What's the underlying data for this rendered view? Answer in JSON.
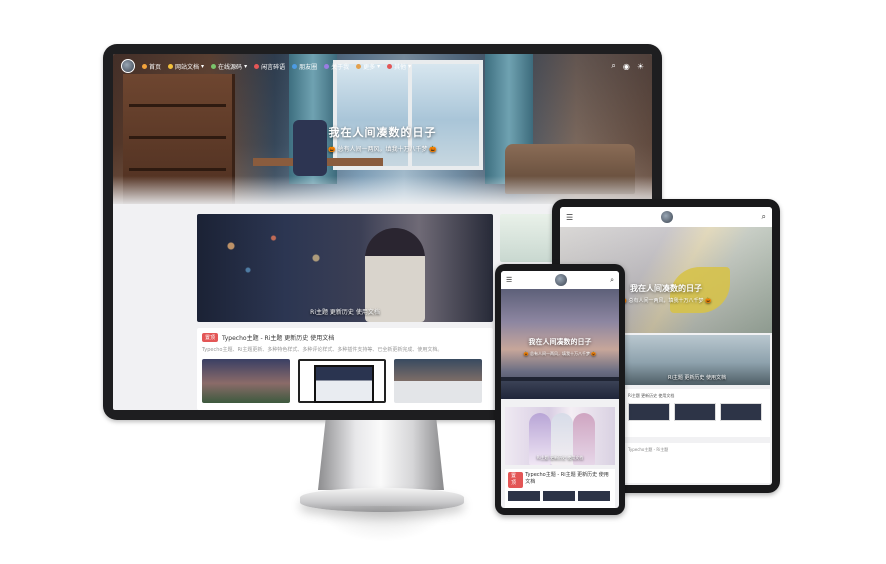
{
  "desktop": {
    "nav": {
      "items": [
        {
          "label": "首页",
          "color": "#f3a33c"
        },
        {
          "label": "网站文档",
          "color": "#f3c13c"
        },
        {
          "label": "在线源码",
          "color": "#7ac46b"
        },
        {
          "label": "闲言碎语",
          "color": "#e35656"
        },
        {
          "label": "朋友圈",
          "color": "#4d9be3"
        },
        {
          "label": "关于我",
          "color": "#9a7de3"
        },
        {
          "label": "更多",
          "color": "#e3a04d"
        },
        {
          "label": "其他",
          "color": "#e35656"
        }
      ],
      "right_icons": [
        "search-icon",
        "user-icon",
        "sun-icon"
      ]
    },
    "hero": {
      "title": "我在人间凑数的日子",
      "subtitle": "🎃 总有人间一两风，填我十万八千梦 🎃"
    },
    "banner": {
      "caption": "Ri主题 更新历史 使用文档"
    },
    "post": {
      "tag": "置顶",
      "title": "Typecho主题 - Ri主题 更新历史 使用文档",
      "desc": "Typecho主题、Ri主题更新、多种特色样式、多种评论样式、多种插件支持等、已全新更新完成、使用文档。"
    }
  },
  "tablet": {
    "hero": {
      "title": "我在人间凑数的日子",
      "subtitle": "🎃 总有人间一两风，填我十万八千梦 🎃"
    },
    "banner": {
      "caption": "Ri主题 更新历史 使用文档"
    },
    "post": {
      "title": "Ri主题 更新历史 使用文档"
    },
    "footer": {
      "text": "Typecho主题 - Ri主题"
    }
  },
  "phone": {
    "hero": {
      "title": "我在人间凑数的日子",
      "subtitle": "🎃 总有人间一两风，填我十万八千梦 🎃"
    },
    "banner": {
      "caption": "Ri主题 更新历史 使用文档"
    },
    "post": {
      "tag": "置顶",
      "title": "Typecho主题 - Ri主题 更新历史 使用文档"
    }
  }
}
